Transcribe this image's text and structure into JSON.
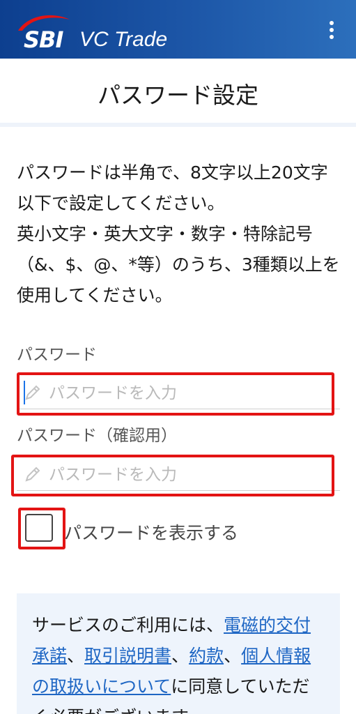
{
  "header": {
    "logo_sbi": "SBI",
    "logo_name": "VC Trade",
    "menu_icon": "more-vertical-icon",
    "colors": {
      "header_start": "#0d3f8f",
      "header_end": "#2c6fbc",
      "logo_swoosh": "#e31414"
    }
  },
  "page": {
    "title": "パスワード設定"
  },
  "description": {
    "line1": "パスワードは半角で、8文字以上20文字以下で設定してください。",
    "line2": "英小文字・英大文字・数字・特除記号（&、$、@、*等）のうち、3種類以上を使用してください。"
  },
  "password_field": {
    "label": "パスワード",
    "placeholder": "パスワードを入力",
    "value": "",
    "icon": "pencil-icon"
  },
  "confirm_field": {
    "label": "パスワード（確認用）",
    "placeholder": "パスワードを入力",
    "value": "",
    "icon": "pencil-icon"
  },
  "show_password": {
    "label": "パスワードを表示する",
    "checked": false
  },
  "notice": {
    "prefix": "サービスのご利用には、",
    "link1": "電磁的交付承諾",
    "sep1": "、",
    "link2": "取引説明書",
    "sep2": "、",
    "link3": "約款",
    "sep3": "、",
    "link4": "個人情報の取扱いについて",
    "suffix": "に同意していただく必要がございます。",
    "link_color": "#1e66c4",
    "background": "#eef4fc"
  },
  "annotation_color": "#e31414"
}
